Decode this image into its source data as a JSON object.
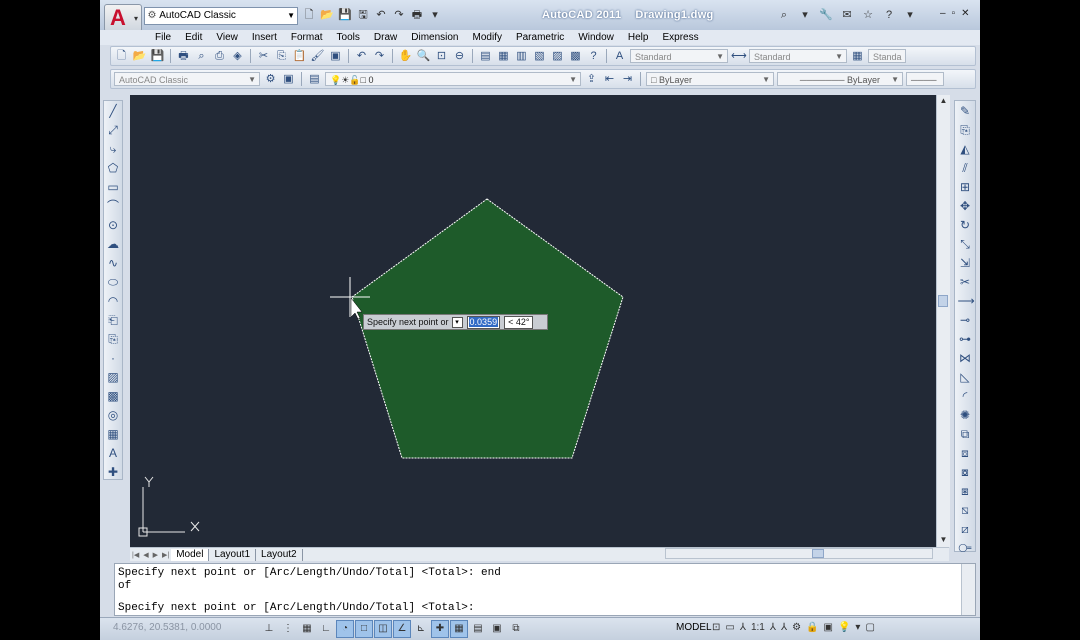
{
  "window": {
    "app_name": "AutoCAD 2011",
    "document": "Drawing1.dwg"
  },
  "workspace": {
    "selected": "AutoCAD Classic"
  },
  "menu": [
    "File",
    "Edit",
    "View",
    "Insert",
    "Format",
    "Tools",
    "Draw",
    "Dimension",
    "Modify",
    "Parametric",
    "Window",
    "Help",
    "Express"
  ],
  "styles_toolbar": {
    "text_style": "Standard",
    "dim_style": "Standard",
    "table_style": "Standa"
  },
  "workspaces_toolbar": {
    "workspace": "AutoCAD Classic"
  },
  "layers_toolbar": {
    "layer": "0"
  },
  "properties_toolbar": {
    "color": "ByLayer",
    "linetype": "ByLayer"
  },
  "drawing": {
    "shape_fill": "#1e5b2a",
    "background": "#222936",
    "dynamic_input": {
      "prompt": "Specify next point or",
      "length_value": "0.0359",
      "angle_value": "< 42°"
    }
  },
  "layout_tabs": [
    "Model",
    "Layout1",
    "Layout2"
  ],
  "command_history": [
    "Specify next point or [Arc/Length/Undo/Total] <Total>: end",
    "of",
    "Specify next point or [Arc/Length/Undo/Total] <Total>:"
  ],
  "status": {
    "coordinates": "4.6276, 20.5381, 0.0000",
    "space": "MODEL",
    "scale": "1:1"
  }
}
